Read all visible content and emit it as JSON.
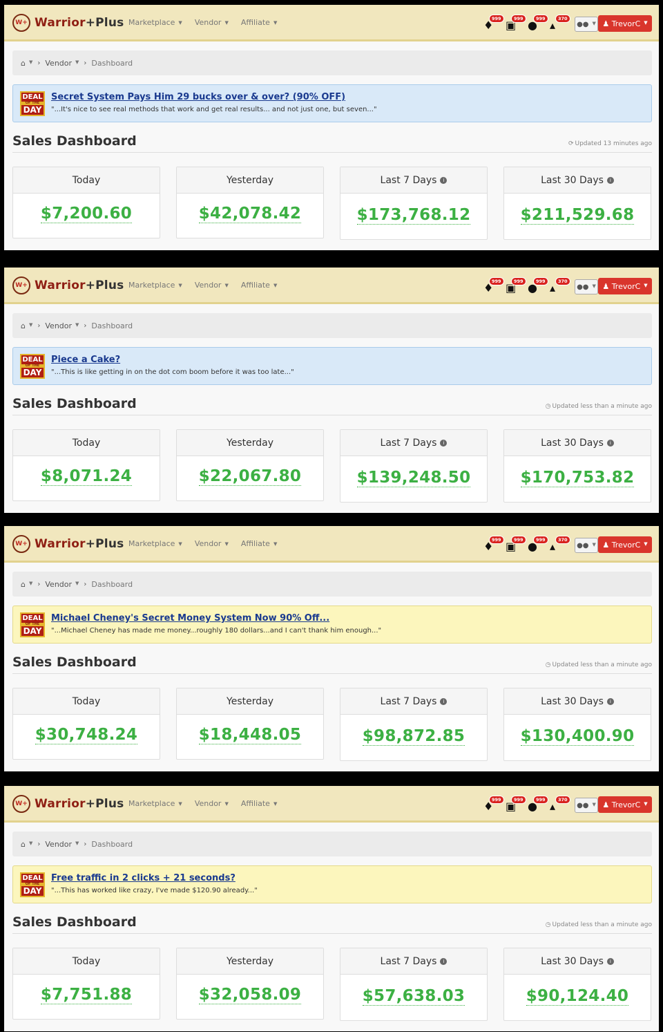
{
  "nav": {
    "brand_main": "Warrior",
    "brand_plus": "+Plus",
    "logo_text": "W+",
    "links": [
      "Marketplace",
      "Vendor",
      "Affiliate"
    ],
    "badges": [
      "999",
      "999",
      "999",
      "370"
    ],
    "user": "TrevorC",
    "icons": [
      "bell-icon",
      "money-icon",
      "users-icon",
      "cart-icon"
    ]
  },
  "breadcrumb": {
    "home": "⌂",
    "vendor": "Vendor",
    "current": "Dashboard"
  },
  "deal_badge": {
    "line1": "DEAL",
    "line2": "OF THE",
    "line3": "DAY"
  },
  "dashboard_title": "Sales Dashboard",
  "card_labels": [
    "Today",
    "Yesterday",
    "Last 7 Days",
    "Last 30 Days"
  ],
  "panels": [
    {
      "deal_title": "Secret System Pays Him 29 bucks over & over? (90% OFF)",
      "deal_quote": "\"...It's nice to see real methods that work and get real results... and not just one, but seven...\"",
      "deal_color": "blue",
      "updated": "Updated 13 minutes ago",
      "values": [
        "$7,200.60",
        "$42,078.42",
        "$173,768.12",
        "$211,529.68"
      ]
    },
    {
      "deal_title": "Piece a Cake?",
      "deal_quote": "\"...This is like getting in on the dot com boom before it was too late...\"",
      "deal_color": "blue",
      "updated": "Updated less than a minute ago",
      "values": [
        "$8,071.24",
        "$22,067.80",
        "$139,248.50",
        "$170,753.82"
      ]
    },
    {
      "deal_title": "Michael Cheney's Secret Money System Now 90% Off...",
      "deal_quote": "\"...Michael Cheney has made me money...roughly 180 dollars...and I can't thank him enough...\"",
      "deal_color": "yellow",
      "updated": "Updated less than a minute ago",
      "values": [
        "$30,748.24",
        "$18,448.05",
        "$98,872.85",
        "$130,400.90"
      ]
    },
    {
      "deal_title": "Free traffic in 2 clicks + 21 seconds?",
      "deal_quote": "\"...This has worked like crazy, I've made $120.90 already...\"",
      "deal_color": "yellow",
      "updated": "Updated less than a minute ago",
      "values": [
        "$7,751.88",
        "$32,058.09",
        "$57,638.03",
        "$90,124.40"
      ]
    }
  ]
}
